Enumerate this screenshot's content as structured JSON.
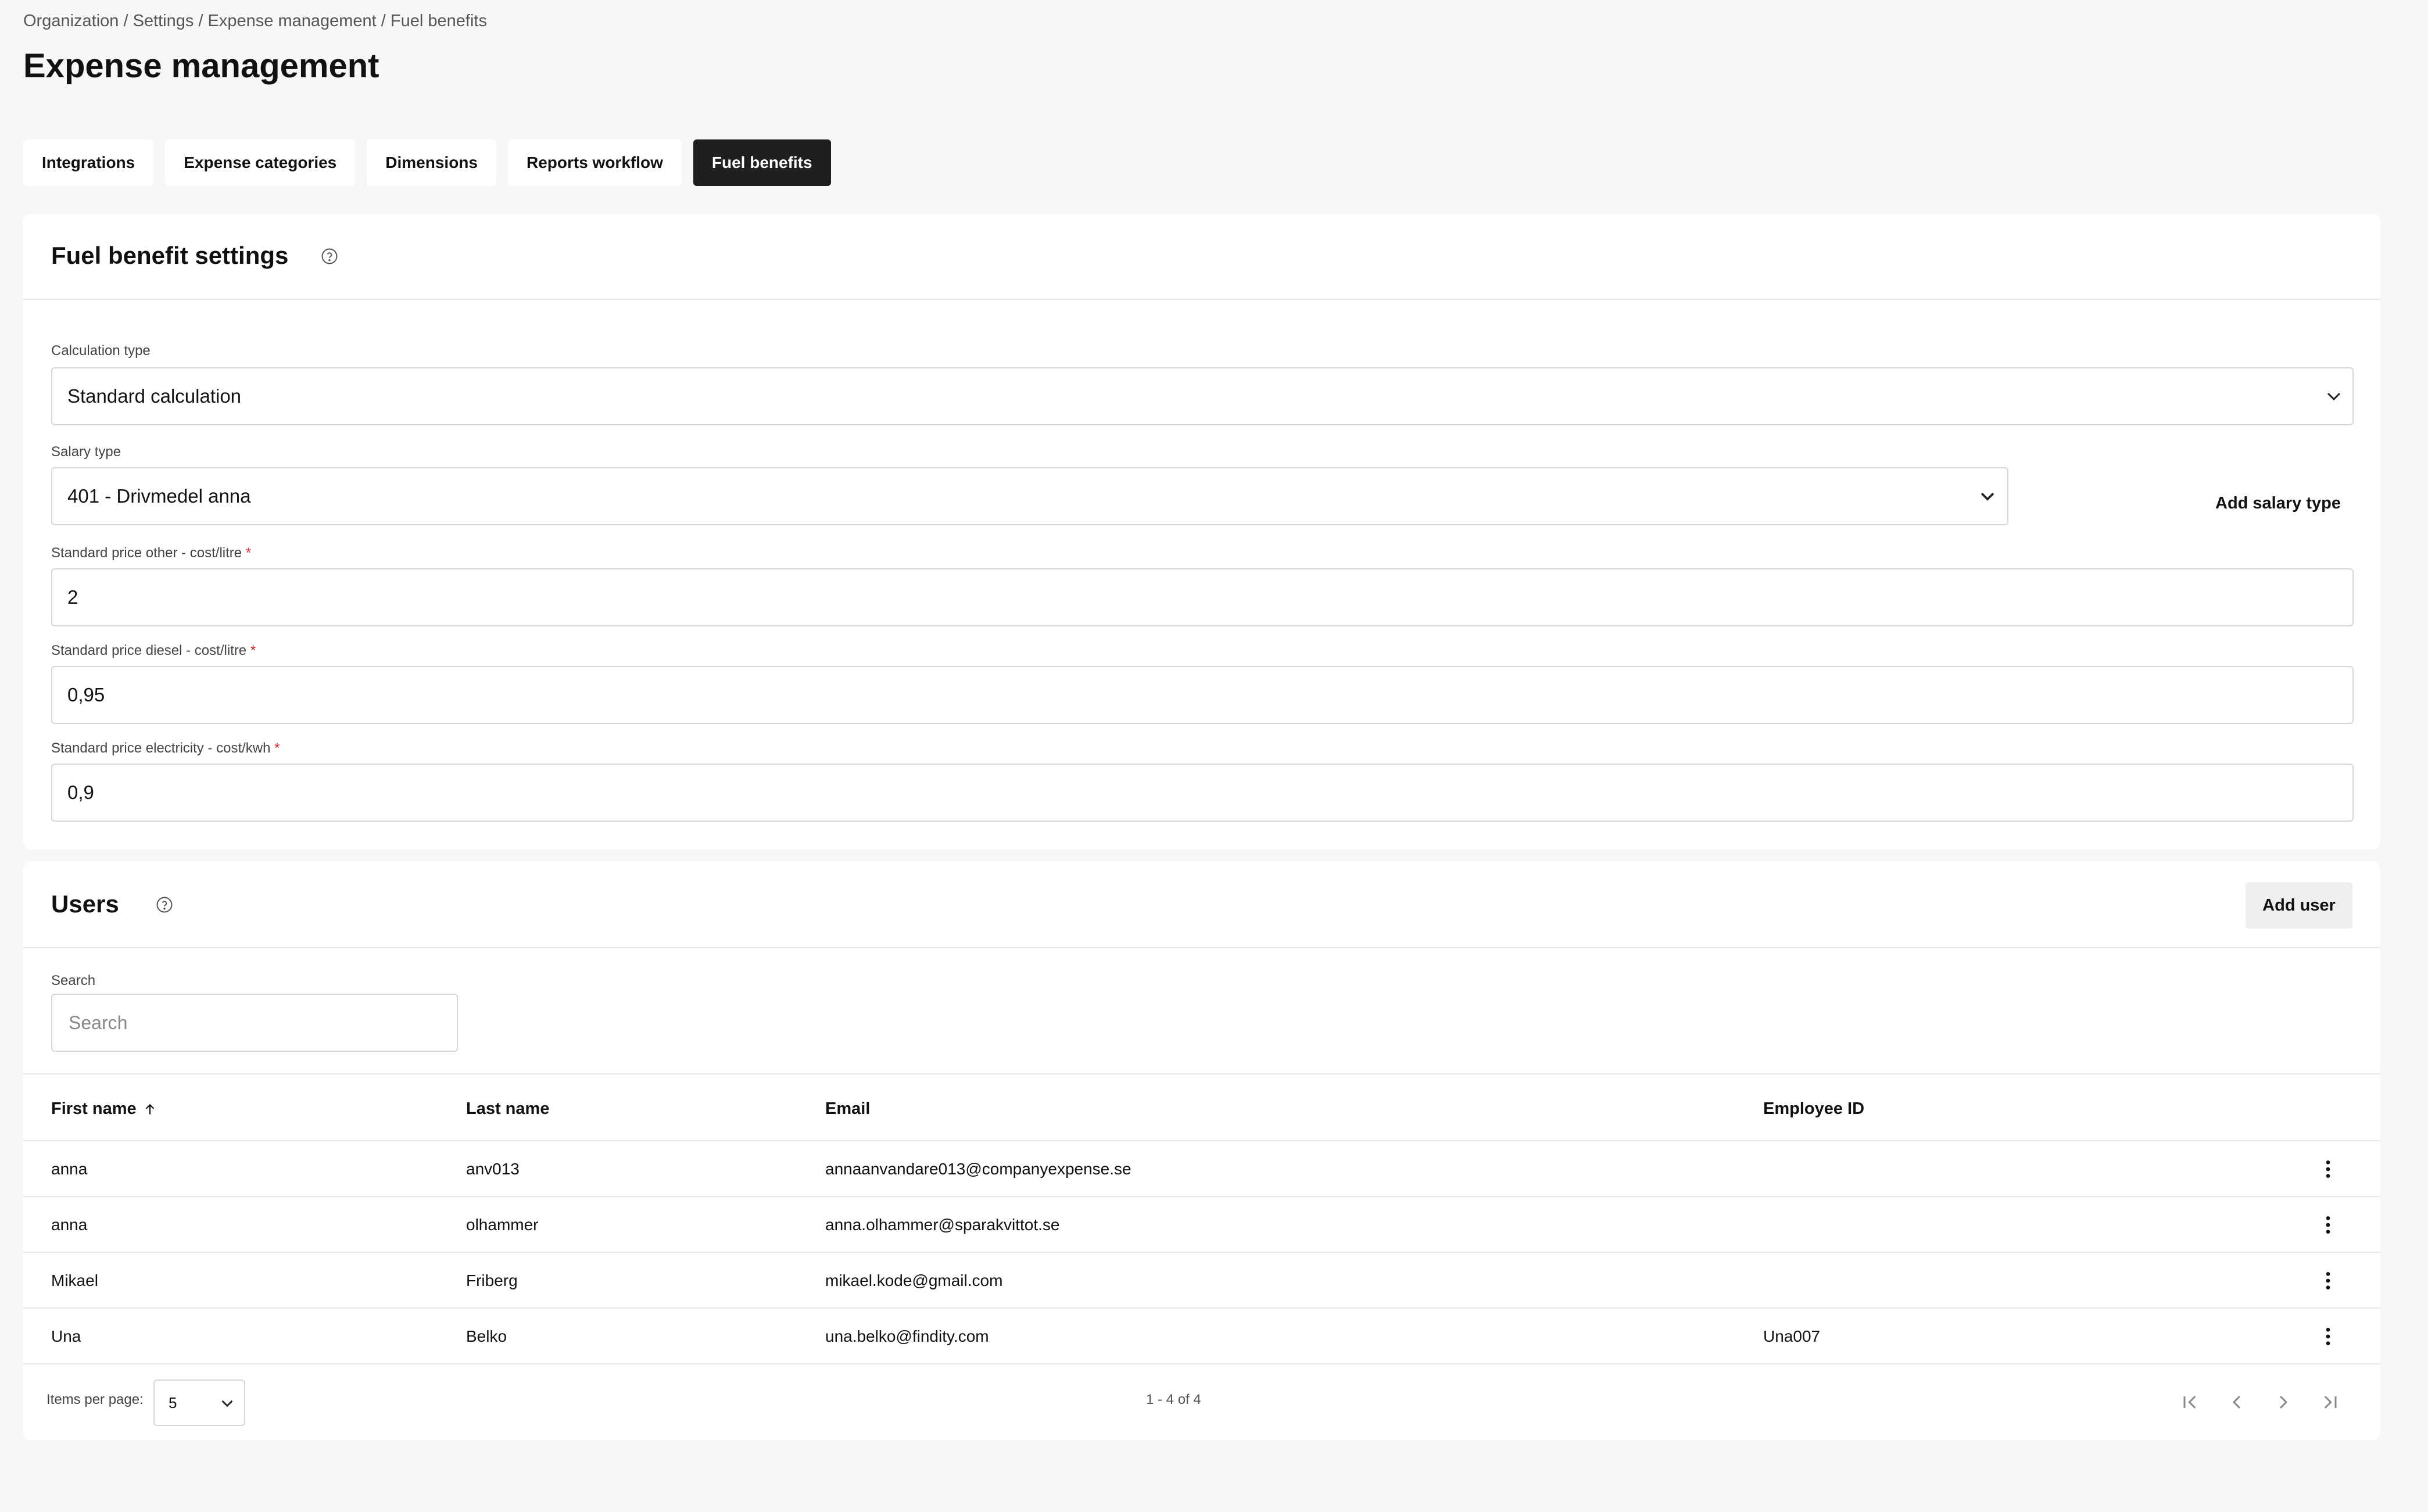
{
  "breadcrumb": "Organization / Settings / Expense management / Fuel benefits",
  "page_title": "Expense management",
  "tabs": [
    {
      "label": "Integrations",
      "active": false
    },
    {
      "label": "Expense categories",
      "active": false
    },
    {
      "label": "Dimensions",
      "active": false
    },
    {
      "label": "Reports workflow",
      "active": false
    },
    {
      "label": "Fuel benefits",
      "active": true
    }
  ],
  "settings": {
    "title": "Fuel benefit settings",
    "calculation_type": {
      "label": "Calculation type",
      "value": "Standard calculation"
    },
    "salary_type": {
      "label": "Salary type",
      "value": "401 - Drivmedel anna"
    },
    "add_salary_type_label": "Add salary type",
    "price_other": {
      "label": "Standard price other - cost/litre",
      "required_mark": "*",
      "value": "2"
    },
    "price_diesel": {
      "label": "Standard price diesel - cost/litre",
      "required_mark": "*",
      "value": "0,95"
    },
    "price_electricity": {
      "label": "Standard price electricity - cost/kwh",
      "required_mark": "*",
      "value": "0,9"
    }
  },
  "users": {
    "title": "Users",
    "add_user_label": "Add user",
    "search_label": "Search",
    "search_placeholder": "Search",
    "search_value": "",
    "columns": {
      "first_name": "First name",
      "last_name": "Last name",
      "email": "Email",
      "employee_id": "Employee ID"
    },
    "sort": {
      "column": "first_name",
      "direction": "ascending"
    },
    "rows": [
      {
        "first_name": "anna",
        "last_name": "anv013",
        "email": "annaanvandare013@companyexpense.se",
        "employee_id": ""
      },
      {
        "first_name": "anna",
        "last_name": "olhammer",
        "email": "anna.olhammer@sparakvittot.se",
        "employee_id": ""
      },
      {
        "first_name": "Mikael",
        "last_name": "Friberg",
        "email": "mikael.kode@gmail.com",
        "employee_id": ""
      },
      {
        "first_name": "Una",
        "last_name": "Belko",
        "email": "una.belko@findity.com",
        "employee_id": "Una007"
      }
    ],
    "pagination": {
      "items_per_page_label": "Items per page:",
      "items_per_page": "5",
      "range_text": "1 - 4 of 4"
    }
  },
  "icons": {
    "help": "help-circle-icon",
    "chevron": "chevron-down-icon",
    "sort": "arrow-up-icon",
    "row_menu": "more-vertical-icon",
    "first_page": "first-page-icon",
    "prev_page": "prev-page-icon",
    "next_page": "next-page-icon",
    "last_page": "last-page-icon"
  },
  "colors": {
    "background": "#f7f7f7",
    "card": "#ffffff",
    "active_tab": "#1f1f1f",
    "required": "#d32f2f",
    "border": "#d6d6d6"
  }
}
